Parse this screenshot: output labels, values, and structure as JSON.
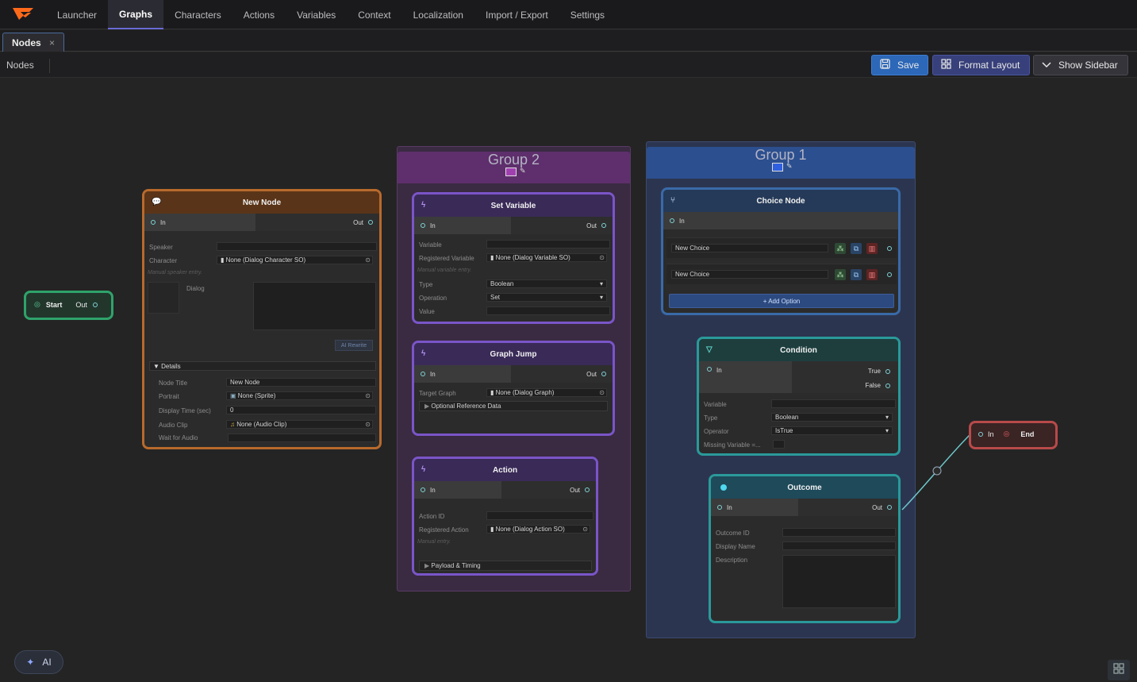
{
  "nav": {
    "items": [
      "Launcher",
      "Graphs",
      "Characters",
      "Actions",
      "Variables",
      "Context",
      "Localization",
      "Import / Export",
      "Settings"
    ],
    "active": "Graphs"
  },
  "tab": {
    "label": "Nodes",
    "close": "×"
  },
  "toolbar": {
    "breadcrumb": "Nodes",
    "save_label": "Save",
    "format_label": "Format Layout",
    "sidebar_label": "Show Sidebar"
  },
  "groups": {
    "group2": {
      "title": "Group 2",
      "color": "#a040b0"
    },
    "group1": {
      "title": "Group 1",
      "color": "#3060e0"
    }
  },
  "start_node": {
    "title": "Start",
    "out": "Out"
  },
  "end_node": {
    "in": "In",
    "title": "End"
  },
  "new_node": {
    "title": "New Node",
    "in": "In",
    "out": "Out",
    "speaker_label": "Speaker",
    "character_label": "Character",
    "character_value": "None (Dialog Character SO)",
    "speaker_hint": "Manual speaker entry.",
    "dialog_label": "Dialog",
    "ai_rewrite": "AI Rewrite",
    "details_label": "Details",
    "node_title_label": "Node Title",
    "node_title_value": "New Node",
    "portrait_label": "Portrait",
    "portrait_value": "None (Sprite)",
    "display_time_label": "Display Time (sec)",
    "display_time_value": "0",
    "audio_clip_label": "Audio Clip",
    "audio_clip_value": "None (Audio Clip)",
    "wait_audio_label": "Wait for Audio"
  },
  "set_variable": {
    "title": "Set Variable",
    "in": "In",
    "out": "Out",
    "variable_label": "Variable",
    "registered_label": "Registered Variable",
    "registered_value": "None (Dialog Variable SO)",
    "hint": "Manual variable entry.",
    "type_label": "Type",
    "type_value": "Boolean",
    "operation_label": "Operation",
    "operation_value": "Set",
    "value_label": "Value"
  },
  "graph_jump": {
    "title": "Graph Jump",
    "in": "In",
    "out": "Out",
    "target_label": "Target Graph",
    "target_value": "None (Dialog Graph)",
    "optional_label": "Optional Reference Data"
  },
  "action": {
    "title": "Action",
    "in": "In",
    "out": "Out",
    "action_id_label": "Action ID",
    "registered_label": "Registered Action",
    "registered_value": "None (Dialog Action SO)",
    "hint": "Manual entry.",
    "payload_label": "Payload & Timing"
  },
  "choice_node": {
    "title": "Choice Node",
    "in": "In",
    "choices": [
      "New Choice",
      "New Choice"
    ],
    "add_option": "+ Add Option"
  },
  "condition": {
    "title": "Condition",
    "in": "In",
    "true_label": "True",
    "false_label": "False",
    "variable_label": "Variable",
    "type_label": "Type",
    "type_value": "Boolean",
    "operator_label": "Operator",
    "operator_value": "IsTrue",
    "missing_label": "Missing Variable =..."
  },
  "outcome": {
    "title": "Outcome",
    "in": "In",
    "out": "Out",
    "outcome_id_label": "Outcome ID",
    "display_name_label": "Display Name",
    "description_label": "Description"
  },
  "ai_button": {
    "label": "AI"
  },
  "colors": {
    "accent_blue": "#2c67b8",
    "dialog_node": "#b86a2c",
    "start_node": "#2fa36a",
    "end_node": "#b84a4a",
    "action_nodes": "#7a55c8",
    "choice_node": "#3a6aa8",
    "condition_outcome": "#2a9a9a"
  }
}
